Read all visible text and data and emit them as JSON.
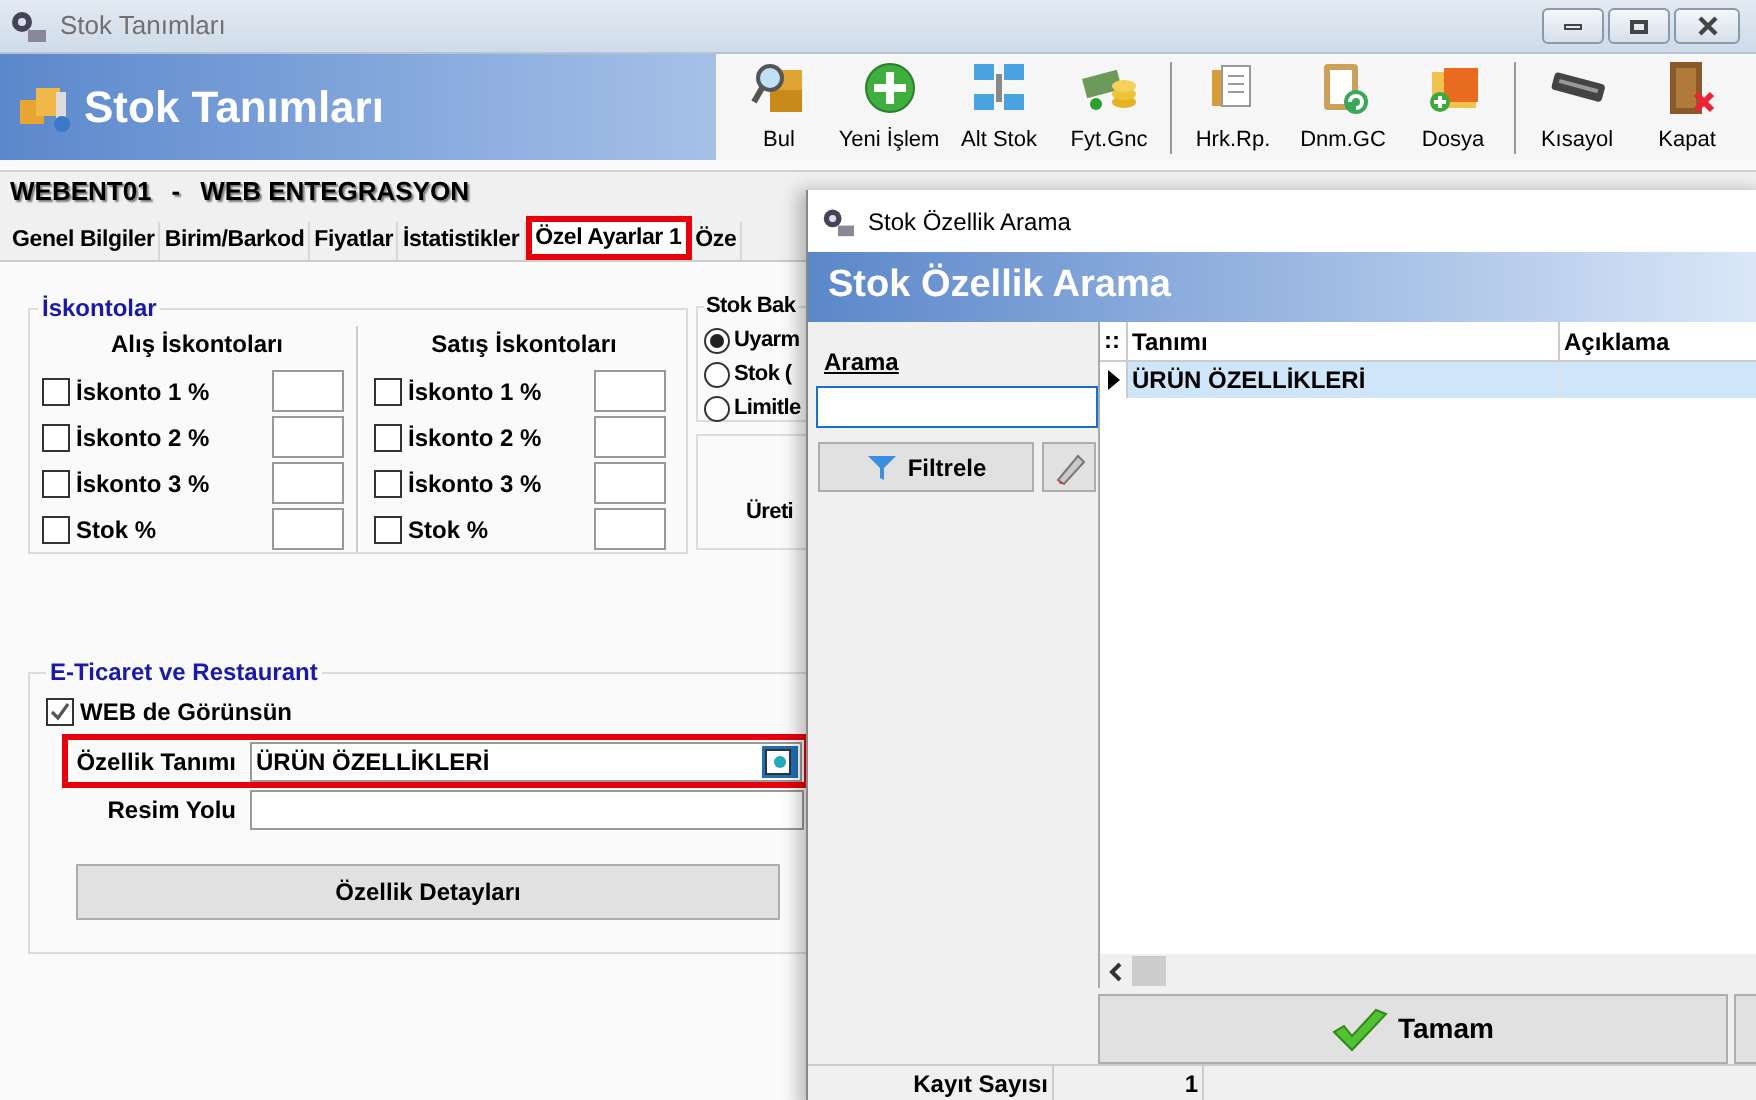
{
  "window": {
    "title": "Stok Tanımları"
  },
  "header": {
    "title": "Stok Tanımları"
  },
  "toolbar_groups": [
    {
      "buttons": [
        "Bul",
        "Yeni İşlem",
        "Alt Stok",
        "Fyt.Gnc"
      ]
    },
    {
      "buttons": [
        "Hrk.Rp.",
        "Dnm.GC",
        "Dosya"
      ]
    },
    {
      "buttons": [
        "Kısayol",
        "Kapat"
      ]
    }
  ],
  "record": {
    "code": "WEBENT01",
    "separator": "-",
    "name": "WEB ENTEGRASYON"
  },
  "tabs": [
    {
      "label": "Genel Bilgiler",
      "selected": false,
      "highlighted": false
    },
    {
      "label": "Birim/Barkod",
      "selected": false,
      "highlighted": false
    },
    {
      "label": "Fiyatlar",
      "selected": false,
      "highlighted": false
    },
    {
      "label": "İstatistikler",
      "selected": false,
      "highlighted": false
    },
    {
      "label": "Özel Ayarlar 1",
      "selected": true,
      "highlighted": true
    },
    {
      "label": "Öze",
      "selected": false,
      "highlighted": false
    }
  ],
  "discounts": {
    "title": "İskontolar",
    "columns": [
      {
        "title": "Alış İskontoları",
        "rows": [
          {
            "label": "İskonto 1 %",
            "checked": false
          },
          {
            "label": "İskonto 2 %",
            "checked": false
          },
          {
            "label": "İskonto 3 %",
            "checked": false
          },
          {
            "label": "Stok %",
            "checked": false
          }
        ]
      },
      {
        "title": "Satış İskontoları",
        "rows": [
          {
            "label": "İskonto 1 %",
            "checked": false
          },
          {
            "label": "İskonto 2 %",
            "checked": false
          },
          {
            "label": "İskonto 3 %",
            "checked": false
          },
          {
            "label": "Stok %",
            "checked": false
          }
        ]
      }
    ]
  },
  "stock_check": {
    "title": "Stok Bak",
    "options": [
      {
        "label": "Uyarm",
        "selected": true
      },
      {
        "label": "Stok (",
        "selected": false
      },
      {
        "label": "Limitle",
        "selected": false
      }
    ]
  },
  "production": {
    "label": "Üreti"
  },
  "ecommerce": {
    "title": "E-Ticaret ve Restaurant",
    "web_visible": {
      "label": "WEB de Görünsün",
      "checked": true
    },
    "feature": {
      "label": "Özellik Tanımı",
      "value": "ÜRÜN ÖZELLİKLERİ",
      "highlighted": true
    },
    "image_path": {
      "label": "Resim Yolu"
    },
    "details_button": "Özellik Detayları"
  },
  "dialog": {
    "title": "Stok Özellik Arama",
    "header": "Stok Özellik Arama",
    "search_label": "Arama",
    "filter_button": "Filtrele",
    "table": {
      "corner": "::",
      "columns": [
        "Tanımı",
        "Açıklama"
      ],
      "rows": [
        {
          "name": "ÜRÜN ÖZELLİKLERİ",
          "selected": true
        }
      ]
    },
    "ok_button": "Tamam",
    "footer": {
      "label": "Kayıt Sayısı",
      "value": "1"
    }
  }
}
